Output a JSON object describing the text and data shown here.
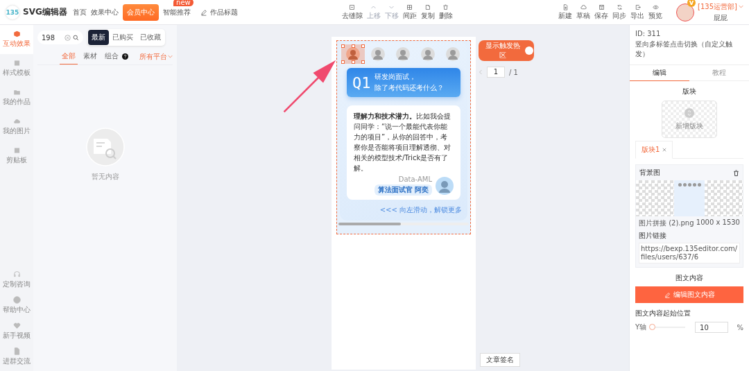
{
  "topbar": {
    "logo": "135",
    "app_title": "SVG编辑器",
    "nav": [
      {
        "label": "首页",
        "kind": "link"
      },
      {
        "label": "效果中心",
        "kind": "link"
      },
      {
        "label": "会员中心",
        "kind": "highlight"
      },
      {
        "label": "智能推荐",
        "kind": "link",
        "badge": "new"
      }
    ],
    "work_title": "作品标题",
    "edit_tools": [
      {
        "label": "去缝隙",
        "disabled": false
      },
      {
        "label": "上移",
        "disabled": true
      },
      {
        "label": "下移",
        "disabled": true
      },
      {
        "label": "间距",
        "disabled": false
      },
      {
        "label": "复制",
        "disabled": false
      },
      {
        "label": "删除",
        "disabled": false
      }
    ],
    "file_tools": [
      {
        "label": "新建"
      },
      {
        "label": "草稿"
      },
      {
        "label": "保存"
      },
      {
        "label": "同步"
      },
      {
        "label": "导出"
      },
      {
        "label": "预览"
      }
    ],
    "user": {
      "badge": "v",
      "team": "[135运营部]",
      "name": "屁屁"
    }
  },
  "rail": {
    "items": [
      {
        "label": "互动效果",
        "selected": true
      },
      {
        "label": "样式模板",
        "selected": false
      },
      {
        "label": "我的作品",
        "selected": false
      },
      {
        "label": "我的图片",
        "selected": false
      },
      {
        "label": "剪贴板",
        "selected": false
      }
    ],
    "bottom_items": [
      {
        "label": "定制咨询"
      },
      {
        "label": "帮助中心"
      },
      {
        "label": "新手视频"
      },
      {
        "label": "进群交流"
      }
    ]
  },
  "library": {
    "search": {
      "value": "198"
    },
    "sort_tabs": [
      {
        "label": "最新",
        "selected": true
      },
      {
        "label": "已购买",
        "selected": false
      },
      {
        "label": "已收藏",
        "selected": false
      }
    ],
    "filter_tabs": [
      {
        "label": "全部",
        "selected": true,
        "help": false
      },
      {
        "label": "素材",
        "selected": false,
        "help": false
      },
      {
        "label": "组合",
        "selected": false,
        "help": true
      }
    ],
    "platform": "所有平台",
    "empty_text": "暂无内容"
  },
  "canvas": {
    "hotspot_toggle": {
      "label": "显示触发热区",
      "on": true
    },
    "pager": {
      "current": "1",
      "total": "/ 1"
    },
    "avatars": [
      {
        "selected": true
      },
      {
        "selected": false
      },
      {
        "selected": false
      },
      {
        "selected": false
      },
      {
        "selected": false
      }
    ],
    "question": {
      "number": "Q1",
      "lines": [
        "研发岗面试，",
        "除了考代码还考什么？"
      ]
    },
    "answer": "**理解力和技术潜力。**比如我会提问同学：“说一个最能代表你能力的项目”，从你的回答中，考察你是否能将项目理解透彻、对相关的模型技术/Trick是否有了解。",
    "author": {
      "caption": "Data-AML",
      "tag": "算法面试官 阿奕"
    },
    "swipe_hint": "<<< 向左滑动，解锁更多",
    "signature_button": "文章签名"
  },
  "inspector": {
    "id": "ID: 311",
    "name": "竖向多标签点击切换（自定义触发）",
    "tabs": [
      {
        "label": "编辑",
        "selected": true
      },
      {
        "label": "教程",
        "selected": false
      }
    ],
    "blocks_title": "版块",
    "add_block": "新增版块",
    "blocks": [
      {
        "label": "版块1",
        "selected": true
      }
    ],
    "background": {
      "title": "背景图",
      "file": "图片拼接 (2).png",
      "size": "1000 x 1530",
      "link_label": "图片链接",
      "url": "https://bexp.135editor.com/files/users/637/6"
    },
    "content_title": "图文内容",
    "edit_button": "编辑图文内容",
    "position": {
      "title": "图文内容起始位置",
      "axis": "Y轴",
      "level": 0.05,
      "value": "10",
      "unit": "%"
    }
  }
}
